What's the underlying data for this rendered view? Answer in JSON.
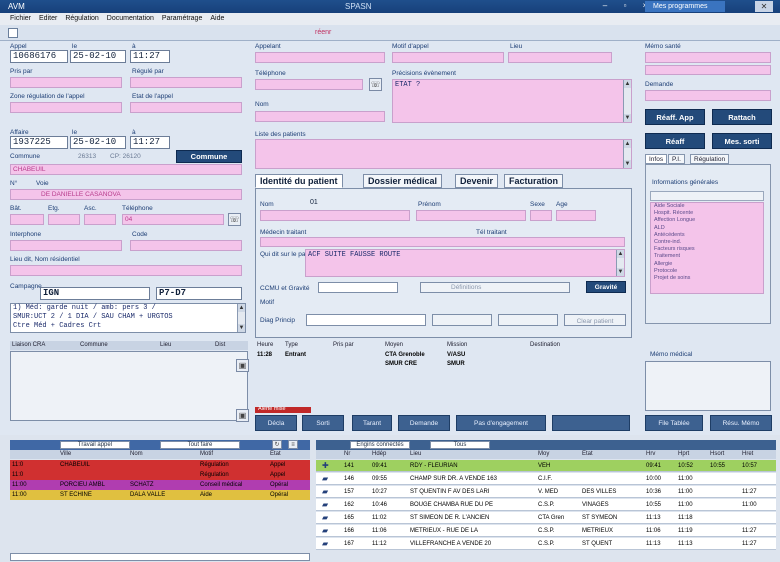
{
  "window": {
    "app_name": "AVM",
    "title": "SPASN",
    "right_label": "Mes programmes",
    "close": "✕"
  },
  "menu": [
    "Fichier",
    "Editer",
    "Régulation",
    "Documentation",
    "Paramétrage",
    "Aide"
  ],
  "toolbar": {
    "title": "réenr"
  },
  "appel": {
    "label": "Appel",
    "col_le": "le",
    "col_a": "à",
    "number": "10686176",
    "date": "25-02-10",
    "time": "11:27",
    "pris_par_label": "Pris par",
    "regule_par_label": "Régulé par",
    "zone_label": "Zone régulation de l'appel",
    "etat_label": "Etat de l'appel"
  },
  "affaire": {
    "label": "Affaire",
    "col_le": "le",
    "col_a": "à",
    "number": "1937225",
    "date": "25-02-10",
    "time": "11:27",
    "commune_label": "Commune",
    "commune_code": "26313",
    "cp": "CP: 26120",
    "commune_button": "Commune",
    "commune_value": "CHABEUIL",
    "num_label": "N°",
    "voie_label": "Voie",
    "voie_value": "DE DANIELLE CASANOVA",
    "bat_label": "Bât.",
    "etg_label": "Etg.",
    "asc_label": "Asc.",
    "tel_label": "Téléphone",
    "tel_value": "04",
    "interphone_label": "Interphone",
    "code_label": "Code",
    "lieu_label": "Lieu dit, Nom résidentiel",
    "campagne_label": "Campagne",
    "campagne_value": "IGN",
    "campagne_ref": "P7-D7",
    "note_lines": [
      "1) Méd: garde nuit / amb: pers 3 /",
      "SMUR:UCT 2 / 1 DIA / SAU CHAM + URGTOS",
      "Ctre Méd + Cadres Crt"
    ]
  },
  "left_list": {
    "header_cols": [
      "Liaison CRA",
      "Commune",
      "Lieu",
      "Dist"
    ]
  },
  "appelant": {
    "label": "Appelant",
    "motif_label": "Motif d'appel",
    "lieu_label": "Lieu",
    "tel_label": "Téléphone",
    "precision_label": "Précisions évènement",
    "precision_value": "ETAT ?",
    "nom_label": "Nom",
    "liste_label": "Liste des patients"
  },
  "tabs": [
    "Identité du patient",
    "Dossier médical",
    "Devenir",
    "Facturation"
  ],
  "patient": {
    "nom_label": "Nom",
    "nom_value": "01",
    "prenom_label": "Prénom",
    "sexe_label": "Sexe",
    "age_label": "Age",
    "medecin_label": "Médecin traitant",
    "tel_label": "Tél traitant",
    "qui_label": "Qui dit sur le patient",
    "qui_value": "ACF SUITE FAUSSE ROUTE",
    "ccmu_label": "CCMU et Gravité",
    "ccmu_button": "Gravité",
    "motif_label": "Motif",
    "diag_label": "Diag Princip",
    "btn_gravite_inner": "Définitions",
    "btn_clear": "Clear patient"
  },
  "side_buttons": [
    "Réaff. App",
    "Rattach",
    "Réaff",
    "Mes. sorti"
  ],
  "side": {
    "memo_label": "Mémo santé",
    "demande_label": "Demande",
    "tabs": [
      "Infos",
      "P.I.",
      "Régulation"
    ],
    "info_title": "Informations générales",
    "info_items": [
      "Aide Sociale",
      "Hospit. Récente",
      "Affection Longue",
      "ALD",
      "Antécédents",
      "Contre-ind.",
      "Facteurs risques",
      "Traitement",
      "Allergie",
      "Protocole",
      "Projet de soins"
    ]
  },
  "history": {
    "cols": [
      "Heure",
      "Type",
      "Pris par",
      "Moyen",
      "Mission",
      "Destination"
    ],
    "time": "11:28",
    "type": "Entrant",
    "moyen1": "CTA Grenoble",
    "mission1": "V/ASU",
    "moyen2": "SMUR CRE",
    "mission2": "SMUR",
    "memo_title": "Mémo médical"
  },
  "action_buttons": [
    "Décla",
    "Sorti",
    "Tarant",
    "Demande",
    "Pas d'engagement",
    "",
    "File Tablée",
    "Résu. Mémo"
  ],
  "alert_button": "Alerte mise",
  "bottom_left": {
    "selector": "Travail appel",
    "selector2": "Tout faire",
    "cols": [
      "Ville",
      "Nom",
      "Motif",
      "Etat"
    ],
    "rows": [
      {
        "time": "11:0",
        "ville": "CHABEUIL",
        "nom": "",
        "motif": "Régulation",
        "etat": "Appel",
        "color": "#d03030"
      },
      {
        "time": "11:0",
        "ville": "",
        "nom": "",
        "motif": "Régulation",
        "etat": "Appel",
        "color": "#d03030"
      },
      {
        "time": "11:00",
        "ville": "PORCIEU AMBL",
        "nom": "SCHATZ",
        "motif": "Conseil médical",
        "etat": "Opéral",
        "color": "#b03db0"
      },
      {
        "time": "11:00",
        "ville": "ST ECHINE",
        "nom": "DALA VALLE",
        "motif": "Aide",
        "etat": "Opéral",
        "color": "#e0c040"
      }
    ]
  },
  "bottom_right": {
    "filter": "Engins connectés",
    "filter2": "Tous",
    "cols": [
      "Nr",
      "Hdép",
      "Lieu",
      "Moy",
      "Etat",
      "Hrv",
      "Hprt",
      "Hsort",
      "Hret"
    ],
    "rows": [
      {
        "nr": "141",
        "h": "09:41",
        "lieu": "RDY - FLEURIAN",
        "moy": "VEH",
        "etat": "",
        "t1": "09:41",
        "t2": "10:52",
        "t3": "10:55",
        "t4": "10:57",
        "color": "#9ed060"
      },
      {
        "nr": "146",
        "h": "09:55",
        "lieu": "CHAMP SUR DR. A VENDE 163",
        "moy": "C.I.F.",
        "etat": "",
        "t1": "10:00",
        "t2": "11:00",
        "t3": "",
        "t4": "",
        "color": "#ffffff"
      },
      {
        "nr": "157",
        "h": "10:27",
        "lieu": "ST QUENTIN F AV DES LARI",
        "moy": "V. MED",
        "etat": "DES VILLES",
        "t1": "10:36",
        "t2": "11:00",
        "t3": "",
        "t4": "11:27",
        "color": "#ffffff"
      },
      {
        "nr": "162",
        "h": "10:46",
        "lieu": "BOUGE CHAMBA RUE DU PE",
        "moy": "C.S.P.",
        "etat": "VINAGES",
        "t1": "10:55",
        "t2": "11:00",
        "t3": "",
        "t4": "11:00",
        "color": "#ffffff"
      },
      {
        "nr": "165",
        "h": "11:02",
        "lieu": "ST SIMEON DE R. L'ANCIEN",
        "moy": "CTA Gren",
        "etat": "ST SYMEON",
        "t1": "11:13",
        "t2": "11:18",
        "t3": "",
        "t4": "",
        "color": "#ffffff"
      },
      {
        "nr": "166",
        "h": "11:06",
        "lieu": "METRIEUX - RUE DE LA",
        "moy": "C.S.P.",
        "etat": "METRIEUX",
        "t1": "11:06",
        "t2": "11:19",
        "t3": "",
        "t4": "11:27",
        "color": "#ffffff"
      },
      {
        "nr": "167",
        "h": "11:12",
        "lieu": "VILLEFRANCHE A VENDE 20",
        "moy": "C.S.P.",
        "etat": "ST QUENT",
        "t1": "11:13",
        "t2": "11:13",
        "t3": "",
        "t4": "11:27",
        "color": "#ffffff"
      }
    ]
  }
}
